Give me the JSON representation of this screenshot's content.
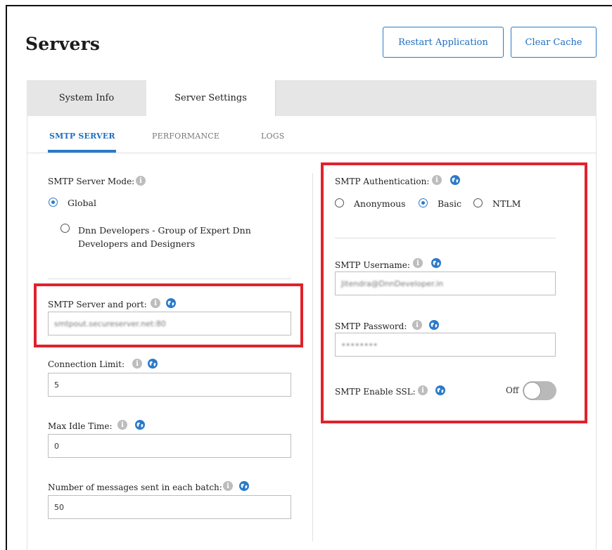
{
  "page": {
    "title": "Servers"
  },
  "header": {
    "restart_label": "Restart Application",
    "clear_cache_label": "Clear Cache"
  },
  "tabs": [
    {
      "label": "System Info",
      "active": false
    },
    {
      "label": "Server Settings",
      "active": true
    }
  ],
  "subtabs": [
    {
      "label": "SMTP SERVER",
      "active": true
    },
    {
      "label": "PERFORMANCE",
      "active": false
    },
    {
      "label": "LOGS",
      "active": false
    }
  ],
  "left": {
    "mode_label": "SMTP Server Mode:",
    "mode_options": [
      {
        "label": "Global",
        "selected": true
      },
      {
        "label": "Dnn Developers - Group of Expert Dnn Developers and Designers",
        "selected": false
      }
    ],
    "server_port_label": "SMTP Server and port:",
    "server_port_value": "smtpout.secureserver.net:80",
    "connection_limit_label": "Connection Limit:",
    "connection_limit_value": "5",
    "max_idle_label": "Max Idle Time:",
    "max_idle_value": "0",
    "batch_label": "Number of messages sent in each batch:",
    "batch_value": "50"
  },
  "right": {
    "auth_label": "SMTP Authentication:",
    "auth_options": [
      {
        "label": "Anonymous",
        "selected": false
      },
      {
        "label": "Basic",
        "selected": true
      },
      {
        "label": "NTLM",
        "selected": false
      }
    ],
    "username_label": "SMTP Username:",
    "username_value": "Jitendra@DnnDeveloper.in",
    "password_label": "SMTP Password:",
    "password_value": "••••••••",
    "ssl_label": "SMTP Enable SSL:",
    "ssl_state_label": "Off",
    "ssl_enabled": false
  },
  "icons": {
    "info": "info-icon",
    "global": "globe-icon"
  },
  "colors": {
    "accent": "#2b7ac9",
    "highlight": "#e0222c"
  }
}
